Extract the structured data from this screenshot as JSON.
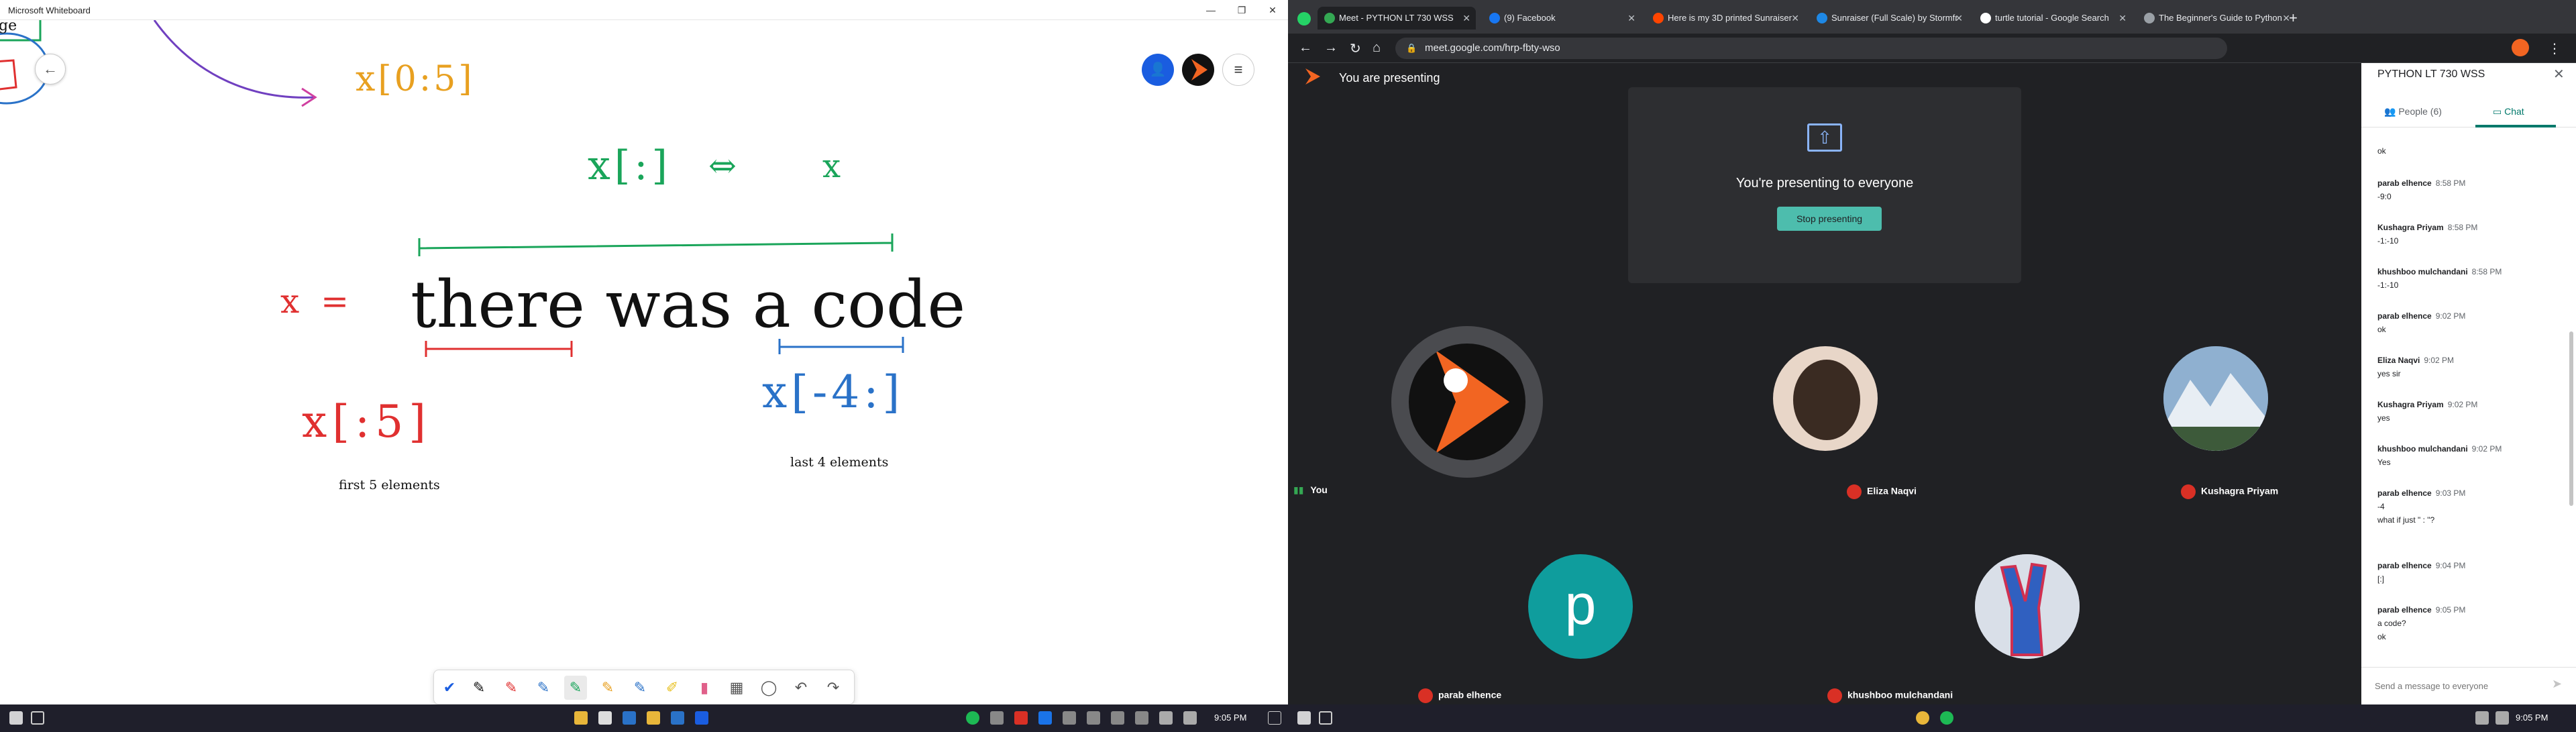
{
  "whiteboard": {
    "title": "Microsoft Whiteboard",
    "ink": {
      "top_fragment": "ge",
      "x_slice_top": "x[0:5]",
      "x_colon": "x[:]",
      "arrow": "⇔",
      "x_alone": "x",
      "x_equals": "x =",
      "string": "there was a code",
      "x_first5": "x[:5]",
      "x_last4": "x[-4:]",
      "caption_first5": "first 5 elements",
      "caption_last4": "last 4 elements"
    },
    "colors": {
      "green": "#1aa55a",
      "red": "#e03030",
      "blue": "#2a72c8",
      "orange": "#e8a020",
      "pink": "#d040a0",
      "black": "#111111"
    }
  },
  "taskbar_left": {
    "time": "9:05 PM"
  },
  "taskbar_right": {
    "time": "9:05 PM"
  },
  "chrome": {
    "tabs": [
      {
        "label": "Meet - PYTHON LT 730 WSS",
        "active": true,
        "color": "#34a853"
      },
      {
        "label": "(9) Facebook",
        "active": false,
        "color": "#1877f2"
      },
      {
        "label": "Here is my 3D printed Sunraiser",
        "active": false,
        "color": "#ff4500"
      },
      {
        "label": "Sunraiser (Full Scale) by Stormfr",
        "active": false,
        "color": "#1e88e5"
      },
      {
        "label": "turtle tutorial - Google Search",
        "active": false,
        "color": "#ffffff"
      },
      {
        "label": "The Beginner's Guide to Python",
        "active": false,
        "color": "#9aa0a6"
      }
    ],
    "url": "meet.google.com/hrp-fbty-wso"
  },
  "meet": {
    "presenting_header": "You are presenting",
    "presenting_title": "You're presenting to everyone",
    "stop_button": "Stop presenting",
    "participants": [
      {
        "name": "You",
        "avatar": "logo"
      },
      {
        "name": "Eliza Naqvi",
        "avatar": "photo"
      },
      {
        "name": "Kushagra Priyam",
        "avatar": "mountain"
      },
      {
        "name": "parab elhence",
        "avatar": "p"
      },
      {
        "name": "khushboo mulchandani",
        "avatar": "hand"
      }
    ],
    "avatar_letter": "p"
  },
  "panel": {
    "title": "PYTHON LT 730 WSS",
    "tab_people": "People (6)",
    "tab_chat": "Chat",
    "send_placeholder": "Send a message to everyone",
    "top_fragment": "ok",
    "messages": [
      {
        "who": "parab elhence",
        "time": "8:58 PM",
        "lines": [
          "-9:0"
        ]
      },
      {
        "who": "Kushagra Priyam",
        "time": "8:58 PM",
        "lines": [
          "-1:-10"
        ]
      },
      {
        "who": "khushboo mulchandani",
        "time": "8:58 PM",
        "lines": [
          "-1:-10"
        ]
      },
      {
        "who": "parab elhence",
        "time": "9:02 PM",
        "lines": [
          "ok"
        ]
      },
      {
        "who": "Eliza Naqvi",
        "time": "9:02 PM",
        "lines": [
          "yes sir"
        ]
      },
      {
        "who": "Kushagra Priyam",
        "time": "9:02 PM",
        "lines": [
          "yes"
        ]
      },
      {
        "who": "khushboo mulchandani",
        "time": "9:02 PM",
        "lines": [
          "Yes"
        ]
      },
      {
        "who": "parab elhence",
        "time": "9:03 PM",
        "lines": [
          "-4",
          "what if just \" : \"?"
        ]
      },
      {
        "who": "parab elhence",
        "time": "9:04 PM",
        "lines": [
          "[:]"
        ]
      },
      {
        "who": "parab elhence",
        "time": "9:05 PM",
        "lines": [
          "a code?",
          "ok"
        ]
      }
    ]
  }
}
